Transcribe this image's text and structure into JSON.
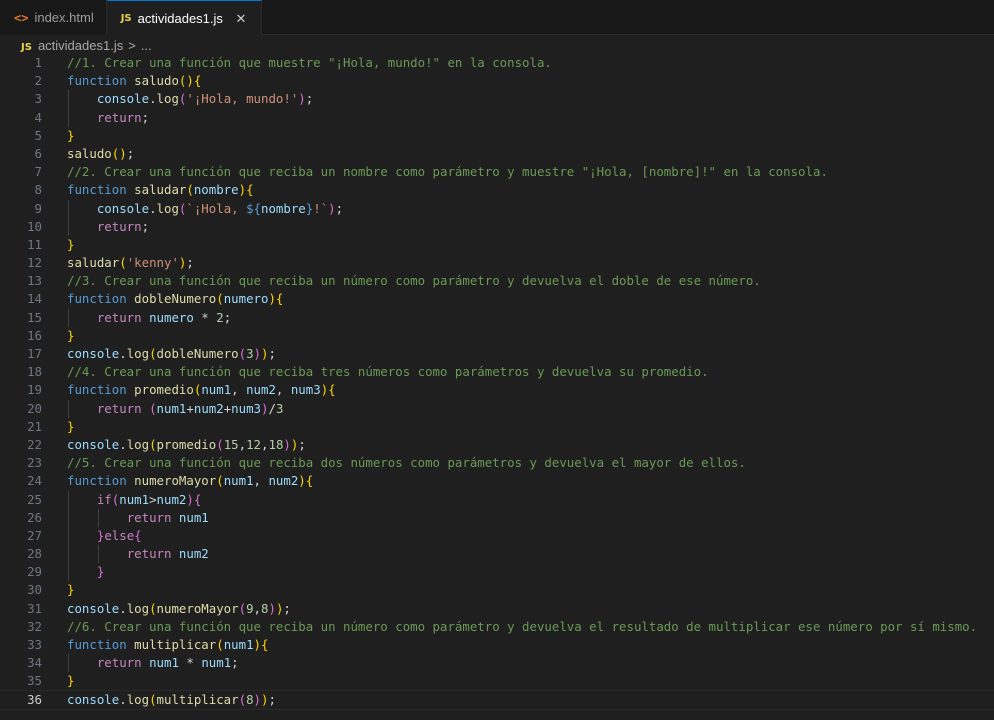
{
  "tabs": [
    {
      "icon": "<>",
      "label": "index.html",
      "active": false
    },
    {
      "icon": "JS",
      "label": "actividades1.js",
      "active": true,
      "close": "✕"
    }
  ],
  "breadcrumb": {
    "icon": "JS",
    "file": "actividades1.js",
    "separator": ">",
    "rest": "..."
  },
  "editor": {
    "current_line": 36,
    "lines": [
      [
        [
          "cm",
          "//1. Crear una función que muestre \"¡Hola, mundo!\" en la consola."
        ]
      ],
      [
        [
          "kw",
          "function"
        ],
        [
          "op",
          " "
        ],
        [
          "fn",
          "saludo"
        ],
        [
          "p1",
          "()"
        ],
        [
          "p1",
          "{"
        ]
      ],
      [
        [
          "op",
          "    "
        ],
        [
          "var",
          "console"
        ],
        [
          "op",
          "."
        ],
        [
          "fn",
          "log"
        ],
        [
          "p2",
          "("
        ],
        [
          "str",
          "'¡Hola, mundo!'"
        ],
        [
          "p2",
          ")"
        ],
        [
          "op",
          ";"
        ]
      ],
      [
        [
          "op",
          "    "
        ],
        [
          "ctl",
          "return"
        ],
        [
          "op",
          ";"
        ]
      ],
      [
        [
          "p1",
          "}"
        ]
      ],
      [
        [
          "fn",
          "saludo"
        ],
        [
          "p1",
          "()"
        ],
        [
          "op",
          ";"
        ]
      ],
      [
        [
          "cm",
          "//2. Crear una función que reciba un nombre como parámetro y muestre \"¡Hola, [nombre]!\" en la consola."
        ]
      ],
      [
        [
          "kw",
          "function"
        ],
        [
          "op",
          " "
        ],
        [
          "fn",
          "saludar"
        ],
        [
          "p1",
          "("
        ],
        [
          "var",
          "nombre"
        ],
        [
          "p1",
          ")"
        ],
        [
          "p1",
          "{"
        ]
      ],
      [
        [
          "op",
          "    "
        ],
        [
          "var",
          "console"
        ],
        [
          "op",
          "."
        ],
        [
          "fn",
          "log"
        ],
        [
          "p2",
          "("
        ],
        [
          "str",
          "`¡Hola, "
        ],
        [
          "kw",
          "${"
        ],
        [
          "var",
          "nombre"
        ],
        [
          "kw",
          "}"
        ],
        [
          "str",
          "!`"
        ],
        [
          "p2",
          ")"
        ],
        [
          "op",
          ";"
        ]
      ],
      [
        [
          "op",
          "    "
        ],
        [
          "ctl",
          "return"
        ],
        [
          "op",
          ";"
        ]
      ],
      [
        [
          "p1",
          "}"
        ]
      ],
      [
        [
          "fn",
          "saludar"
        ],
        [
          "p1",
          "("
        ],
        [
          "str",
          "'kenny'"
        ],
        [
          "p1",
          ")"
        ],
        [
          "op",
          ";"
        ]
      ],
      [
        [
          "cm",
          "//3. Crear una función que reciba un número como parámetro y devuelva el doble de ese número."
        ]
      ],
      [
        [
          "kw",
          "function"
        ],
        [
          "op",
          " "
        ],
        [
          "fn",
          "dobleNumero"
        ],
        [
          "p1",
          "("
        ],
        [
          "var",
          "numero"
        ],
        [
          "p1",
          ")"
        ],
        [
          "p1",
          "{"
        ]
      ],
      [
        [
          "op",
          "    "
        ],
        [
          "ctl",
          "return"
        ],
        [
          "op",
          " "
        ],
        [
          "var",
          "numero"
        ],
        [
          "op",
          " * "
        ],
        [
          "num",
          "2"
        ],
        [
          "op",
          ";"
        ]
      ],
      [
        [
          "p1",
          "}"
        ]
      ],
      [
        [
          "var",
          "console"
        ],
        [
          "op",
          "."
        ],
        [
          "fn",
          "log"
        ],
        [
          "p1",
          "("
        ],
        [
          "fn",
          "dobleNumero"
        ],
        [
          "p2",
          "("
        ],
        [
          "num",
          "3"
        ],
        [
          "p2",
          ")"
        ],
        [
          "p1",
          ")"
        ],
        [
          "op",
          ";"
        ]
      ],
      [
        [
          "cm",
          "//4. Crear una función que reciba tres números como parámetros y devuelva su promedio."
        ]
      ],
      [
        [
          "kw",
          "function"
        ],
        [
          "op",
          " "
        ],
        [
          "fn",
          "promedio"
        ],
        [
          "p1",
          "("
        ],
        [
          "var",
          "num1"
        ],
        [
          "op",
          ", "
        ],
        [
          "var",
          "num2"
        ],
        [
          "op",
          ", "
        ],
        [
          "var",
          "num3"
        ],
        [
          "p1",
          ")"
        ],
        [
          "p1",
          "{"
        ]
      ],
      [
        [
          "op",
          "    "
        ],
        [
          "ctl",
          "return"
        ],
        [
          "op",
          " "
        ],
        [
          "p2",
          "("
        ],
        [
          "var",
          "num1"
        ],
        [
          "op",
          "+"
        ],
        [
          "var",
          "num2"
        ],
        [
          "op",
          "+"
        ],
        [
          "var",
          "num3"
        ],
        [
          "p2",
          ")"
        ],
        [
          "op",
          "/"
        ],
        [
          "num",
          "3"
        ]
      ],
      [
        [
          "p1",
          "}"
        ]
      ],
      [
        [
          "var",
          "console"
        ],
        [
          "op",
          "."
        ],
        [
          "fn",
          "log"
        ],
        [
          "p1",
          "("
        ],
        [
          "fn",
          "promedio"
        ],
        [
          "p2",
          "("
        ],
        [
          "num",
          "15"
        ],
        [
          "op",
          ","
        ],
        [
          "num",
          "12"
        ],
        [
          "op",
          ","
        ],
        [
          "num",
          "18"
        ],
        [
          "p2",
          ")"
        ],
        [
          "p1",
          ")"
        ],
        [
          "op",
          ";"
        ]
      ],
      [
        [
          "cm",
          "//5. Crear una función que reciba dos números como parámetros y devuelva el mayor de ellos."
        ]
      ],
      [
        [
          "kw",
          "function"
        ],
        [
          "op",
          " "
        ],
        [
          "fn",
          "numeroMayor"
        ],
        [
          "p1",
          "("
        ],
        [
          "var",
          "num1"
        ],
        [
          "op",
          ", "
        ],
        [
          "var",
          "num2"
        ],
        [
          "p1",
          ")"
        ],
        [
          "p1",
          "{"
        ]
      ],
      [
        [
          "op",
          "    "
        ],
        [
          "ctl",
          "if"
        ],
        [
          "p2",
          "("
        ],
        [
          "var",
          "num1"
        ],
        [
          "op",
          ">"
        ],
        [
          "var",
          "num2"
        ],
        [
          "p2",
          ")"
        ],
        [
          "p2",
          "{"
        ]
      ],
      [
        [
          "op",
          "        "
        ],
        [
          "ctl",
          "return"
        ],
        [
          "op",
          " "
        ],
        [
          "var",
          "num1"
        ]
      ],
      [
        [
          "op",
          "    "
        ],
        [
          "p2",
          "}"
        ],
        [
          "ctl",
          "else"
        ],
        [
          "p2",
          "{"
        ]
      ],
      [
        [
          "op",
          "        "
        ],
        [
          "ctl",
          "return"
        ],
        [
          "op",
          " "
        ],
        [
          "var",
          "num2"
        ]
      ],
      [
        [
          "op",
          "    "
        ],
        [
          "p2",
          "}"
        ]
      ],
      [
        [
          "p1",
          "}"
        ]
      ],
      [
        [
          "var",
          "console"
        ],
        [
          "op",
          "."
        ],
        [
          "fn",
          "log"
        ],
        [
          "p1",
          "("
        ],
        [
          "fn",
          "numeroMayor"
        ],
        [
          "p2",
          "("
        ],
        [
          "num",
          "9"
        ],
        [
          "op",
          ","
        ],
        [
          "num",
          "8"
        ],
        [
          "p2",
          ")"
        ],
        [
          "p1",
          ")"
        ],
        [
          "op",
          ";"
        ]
      ],
      [
        [
          "cm",
          "//6. Crear una función que reciba un número como parámetro y devuelva el resultado de multiplicar ese número por sí mismo."
        ]
      ],
      [
        [
          "kw",
          "function"
        ],
        [
          "op",
          " "
        ],
        [
          "fn",
          "multiplicar"
        ],
        [
          "p1",
          "("
        ],
        [
          "var",
          "num1"
        ],
        [
          "p1",
          ")"
        ],
        [
          "p1",
          "{"
        ]
      ],
      [
        [
          "op",
          "    "
        ],
        [
          "ctl",
          "return"
        ],
        [
          "op",
          " "
        ],
        [
          "var",
          "num1"
        ],
        [
          "op",
          " * "
        ],
        [
          "var",
          "num1"
        ],
        [
          "op",
          ";"
        ]
      ],
      [
        [
          "p1",
          "}"
        ]
      ],
      [
        [
          "var",
          "console"
        ],
        [
          "op",
          "."
        ],
        [
          "fn",
          "log"
        ],
        [
          "p1",
          "("
        ],
        [
          "fn",
          "multiplicar"
        ],
        [
          "p2",
          "("
        ],
        [
          "num",
          "8"
        ],
        [
          "p2",
          ")"
        ],
        [
          "p1",
          ")"
        ],
        [
          "op",
          ";"
        ]
      ]
    ]
  }
}
